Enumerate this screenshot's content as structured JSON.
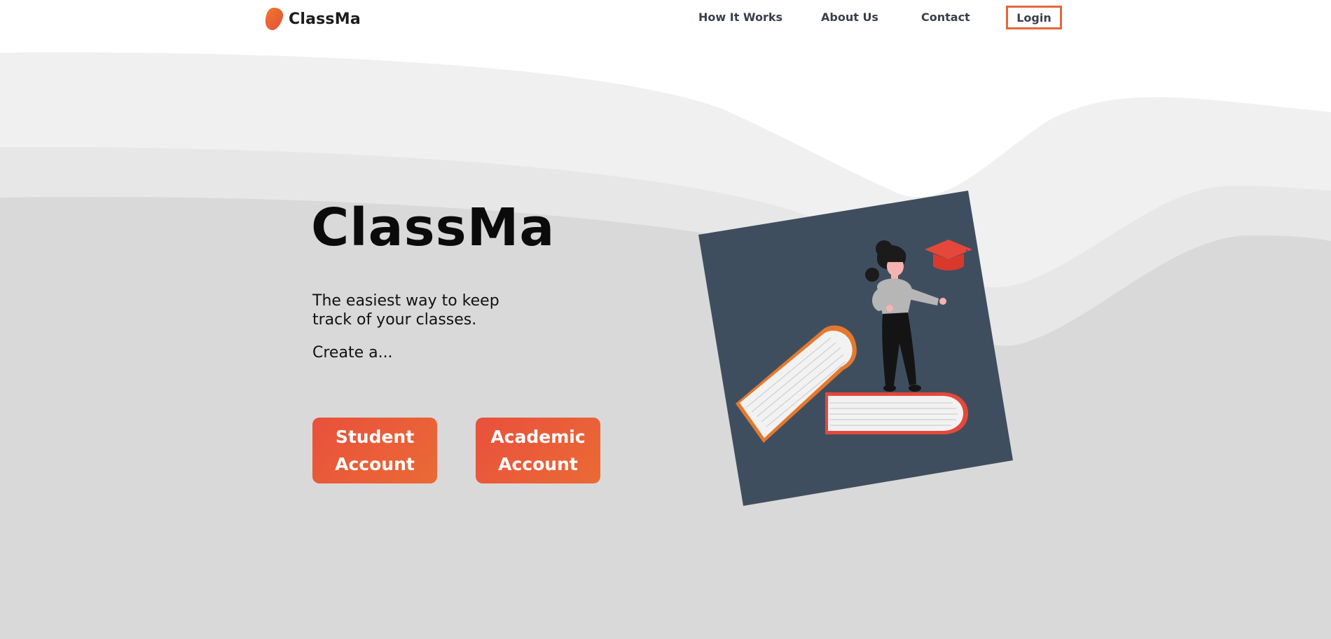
{
  "brand": {
    "name": "ClassMa",
    "logo_icon": "orange-blob-logo-icon"
  },
  "nav": {
    "links": [
      "How It Works",
      "About Us",
      "Contact"
    ],
    "login_label": "Login"
  },
  "hero": {
    "title": "ClassMa",
    "tagline": "The easiest way to keep track of your classes.",
    "create_prompt": "Create a...",
    "buttons": {
      "student": [
        "Student",
        "Account"
      ],
      "academic": [
        "Academic",
        "Account"
      ]
    },
    "illustration": "woman-standing-on-books-with-graduation-cap-illustration"
  },
  "colors": {
    "accent": "#e4673a",
    "button_gradient_start": "#e9503c",
    "button_gradient_end": "#ea6a35",
    "illustration_panel": "#3f4e5f",
    "background_gray": "#d9d9d9"
  }
}
